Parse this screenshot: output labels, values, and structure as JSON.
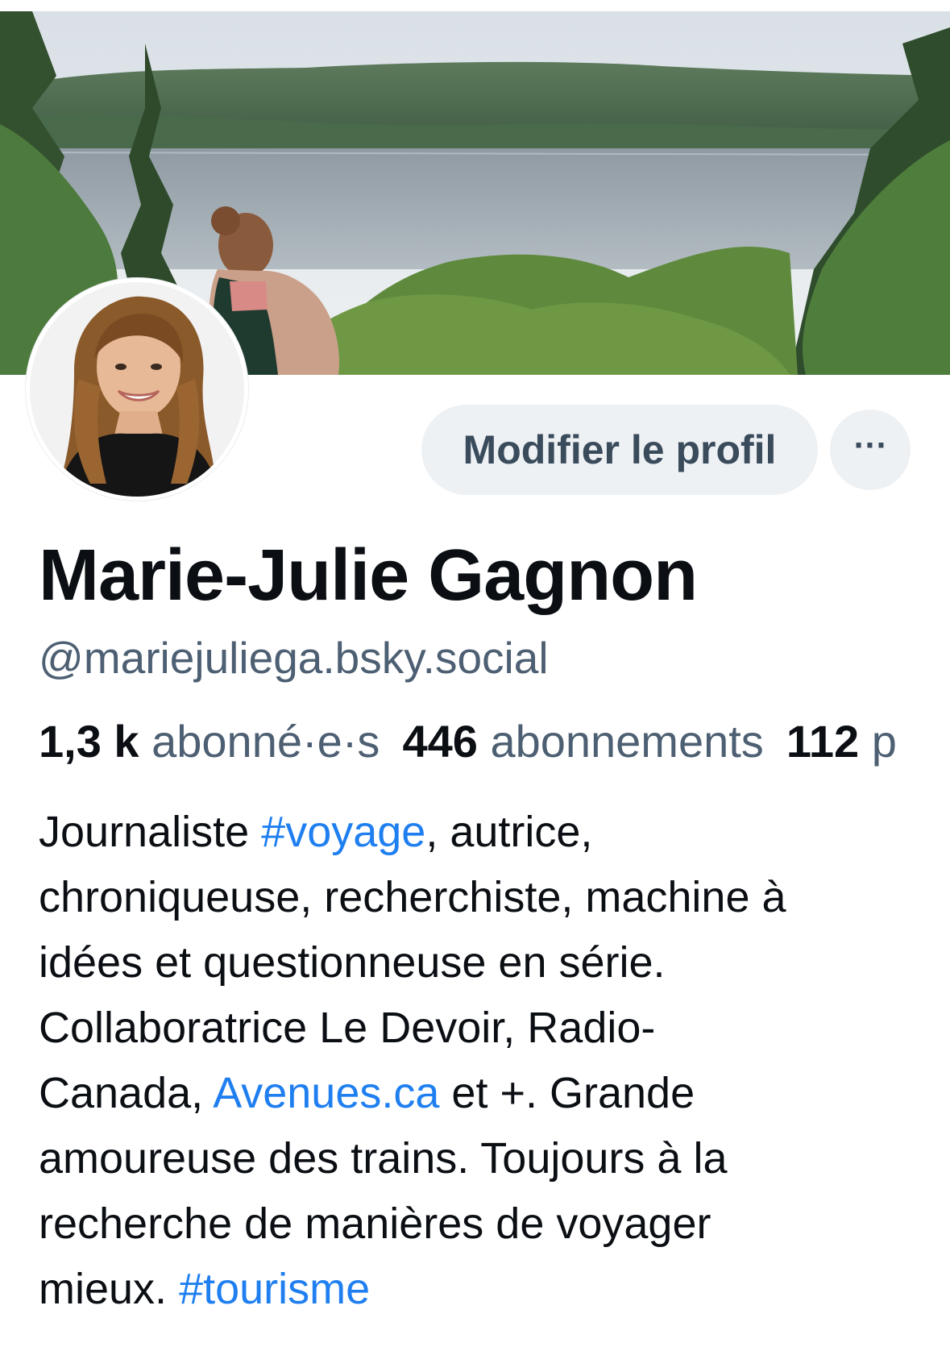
{
  "profile": {
    "display_name": "Marie-Julie Gagnon",
    "handle": "@mariejuliega.bsky.social",
    "edit_button_label": "Modifier le profil",
    "more_icon": "ellipsis-icon",
    "more_label": "···"
  },
  "stats": {
    "followers_count": "1,3 k",
    "followers_label": "abonné·e·s",
    "following_count": "446",
    "following_label": "abonnements",
    "posts_count": "112",
    "posts_label_visible": "p"
  },
  "bio": {
    "line1_pre": "Journaliste ",
    "line1_tag": "#voyage",
    "line1_post": ", autrice,",
    "line2": "chroniqueuse, recherchiste, machine à",
    "line3": "idées et questionneuse en série.",
    "line4": "Collaboratrice Le Devoir, Radio-",
    "line5_pre": "Canada, ",
    "line5_link": "Avenues.ca",
    "line5_post": " et +. Grande",
    "line6": "amoureuse des trains. Toujours à la",
    "line7": "recherche de manières de voyager",
    "line8_pre": "mieux. ",
    "line8_tag": "#tourisme"
  },
  "colors": {
    "link": "#1f7ff0",
    "secondary_text": "#4d5f72",
    "button_bg": "#eef1f4",
    "primary_text": "#0b0f14"
  }
}
